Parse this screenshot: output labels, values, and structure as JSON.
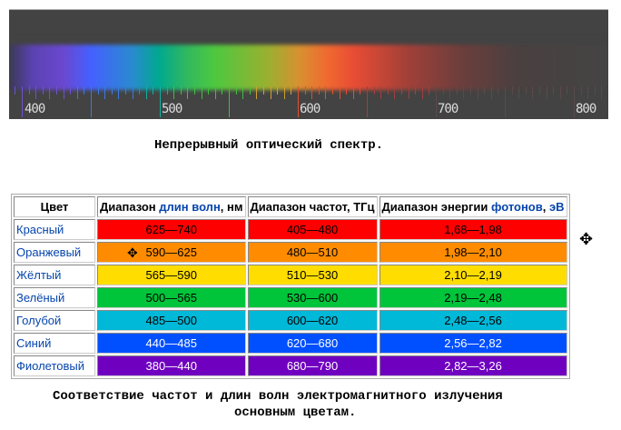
{
  "spectrum": {
    "axis_labels": [
      "400",
      "500",
      "600",
      "700",
      "800"
    ],
    "range_nm": [
      385,
      820
    ]
  },
  "caption_top": "Непрерывный оптический спектр.",
  "table": {
    "headers": {
      "color": "Цвет",
      "wave_pre": "Диапазон ",
      "wave_link": "длин волн",
      "wave_post": ", нм",
      "freq": "Диапазон частот, ТГц",
      "energy_pre": "Диапазон энергии ",
      "energy_link": "фотонов",
      "energy_post": ", ",
      "energy_unit": "эВ"
    },
    "rows": [
      {
        "name": "Красный",
        "wave": "625—740",
        "freq": "405—480",
        "energy": "1,68—1,98",
        "bg": "#ff0000",
        "fg": "#000000"
      },
      {
        "name": "Оранжевый",
        "wave": "590—625",
        "freq": "480—510",
        "energy": "1,98—2,10",
        "bg": "#ff8c00",
        "fg": "#000000"
      },
      {
        "name": "Жёлтый",
        "wave": "565—590",
        "freq": "510—530",
        "energy": "2,10—2,19",
        "bg": "#ffdd00",
        "fg": "#000000"
      },
      {
        "name": "Зелёный",
        "wave": "500—565",
        "freq": "530—600",
        "energy": "2,19—2,48",
        "bg": "#00c43a",
        "fg": "#000000"
      },
      {
        "name": "Голубой",
        "wave": "485—500",
        "freq": "600—620",
        "energy": "2,48—2,56",
        "bg": "#00b8d8",
        "fg": "#000000"
      },
      {
        "name": "Синий",
        "wave": "440—485",
        "freq": "620—680",
        "energy": "2,56—2,82",
        "bg": "#0050ff",
        "fg": "#ffffff"
      },
      {
        "name": "Фиолетовый",
        "wave": "380—440",
        "freq": "680—790",
        "energy": "2,82—3,26",
        "bg": "#7000c0",
        "fg": "#ffffff"
      }
    ]
  },
  "caption_bottom": {
    "line1": "Соответствие частот и длин волн электромагнитного излучения",
    "line2": "основным цветам."
  }
}
